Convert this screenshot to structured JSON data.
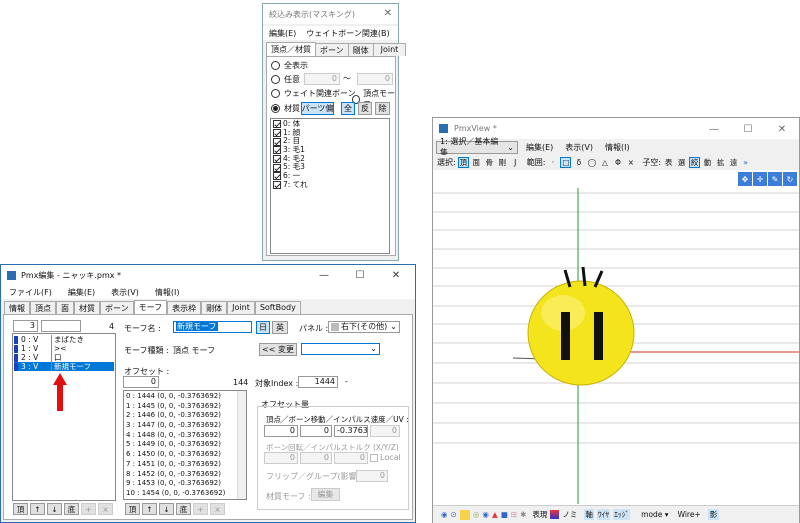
{
  "masking": {
    "title": "絞込み表示(マスキング)",
    "close": "✕",
    "menu": [
      "編集(E)",
      "ウェイトボーン関連(B)"
    ],
    "tabs": [
      "頂点／材質",
      "ボーン",
      "剛体",
      "Joint"
    ],
    "opt_all": "全表示",
    "opt_any": "任意",
    "any_from": "0",
    "tilde": "〜",
    "any_to": "0",
    "opt_weight": "ウェイト関連ボーン",
    "opt_vmorph": "頂点モーフ",
    "opt_material": "材質",
    "btn_parts": "パーツ偏",
    "btn_all": "全",
    "btn_inv": "反",
    "btn_del": "除",
    "materials": [
      "0: 体",
      "1: 顔",
      "2: 目",
      "3: 毛1",
      "4: 毛2",
      "5: 毛3",
      "6: 一",
      "7: てれ"
    ]
  },
  "pmxview": {
    "title": "PmxView *",
    "min": "—",
    "max": "☐",
    "close": "✕",
    "mode_select": "1: 選択／基本編集",
    "menu": [
      "編集(E)",
      "表示(V)",
      "情報(I)"
    ],
    "sel_label": "選択:",
    "sel_items": [
      "頂",
      "面",
      "骨",
      "剛",
      "J"
    ],
    "range_label": "範囲:",
    "range_items": [
      "·",
      "□",
      "δ",
      "◯",
      "△",
      "Φ",
      "×"
    ],
    "axis_label": "子空:",
    "axis_items": [
      "表",
      "選",
      "絞",
      "動",
      "拡",
      "遠"
    ],
    "more": "»",
    "bottom": [
      "表現",
      "ノミ",
      "軸",
      "ﾜｲﾔ",
      "ｴｯｼﾞ",
      "mode ▾",
      "Wire+",
      "影"
    ]
  },
  "pmxedit": {
    "title": "Pmx編集 - ニャッキ.pmx *",
    "min": "—",
    "max": "☐",
    "close": "✕",
    "menu": [
      "ファイル(F)",
      "編集(E)",
      "表示(V)",
      "情報(I)"
    ],
    "tabs": [
      "情報",
      "頂点",
      "面",
      "材質",
      "ボーン",
      "モーフ",
      "表示枠",
      "剛体",
      "Joint",
      "SoftBody"
    ],
    "morph_count": "3",
    "morph_total": "4",
    "morphs": [
      {
        "idx": "0 : V",
        "name": "まばたき"
      },
      {
        "idx": "1 : V",
        "name": "><"
      },
      {
        "idx": "2 : V",
        "name": "口"
      },
      {
        "idx": "3 : V",
        "name": "新規モーフ"
      }
    ],
    "morph_name_label": "モーフ名 :",
    "morph_name_value": "新規モーフ",
    "btn_jp": "日",
    "btn_en": "英",
    "panel_label": "パネル :",
    "panel_value": "右下(その他)",
    "morph_type_label": "モーフ種類 :",
    "morph_type_value": "頂点 モーフ",
    "change_btn": "<< 変更",
    "offset_label": "オフセット :",
    "offset_value": "0",
    "offset_total": "144",
    "offsets": [
      "0 : 1444 (0, 0, -0.3763692)",
      "1 : 1445 (0, 0, -0.3763692)",
      "2 : 1446 (0, 0, -0.3763692)",
      "3 : 1447 (0, 0, -0.3763692)",
      "4 : 1448 (0, 0, -0.3763692)",
      "5 : 1449 (0, 0, -0.3763692)",
      "6 : 1450 (0, 0, -0.3763692)",
      "7 : 1451 (0, 0, -0.3763692)",
      "8 : 1452 (0, 0, -0.3763692)",
      "9 : 1453 (0, 0, -0.3763692)",
      "10 : 1454 (0, 0, -0.3763692)"
    ],
    "target_label": "対象Index :",
    "target_value": "1444",
    "target_dash": "-",
    "offset_amount_label": "オフセット量",
    "vertex_move_label": "頂点／ボーン移動／インパルス速度／UV :",
    "vx": "0",
    "vy": "0",
    "vz": "-0.37636",
    "vw": "0",
    "bone_rot_label": "ボーン回転／インパルストルク (X/Y/Z)",
    "rx": "0",
    "ry": "0",
    "rz": "0",
    "local_label": "Local",
    "flip_label": "フリップ／グループ(影響度) :",
    "flip_value": "0",
    "material_morph_label": "材質モーフ :",
    "edit_btn": "編集",
    "left_bottom_btns": [
      "頂",
      "↑",
      "↓",
      "底",
      "+",
      "×"
    ],
    "mid_bottom_btns": [
      "頂",
      "↑",
      "↓",
      "底",
      "+",
      "×"
    ]
  },
  "colors": {
    "accent": "#0078d7",
    "arrow": "#e01010",
    "face": "#f2e31a"
  }
}
